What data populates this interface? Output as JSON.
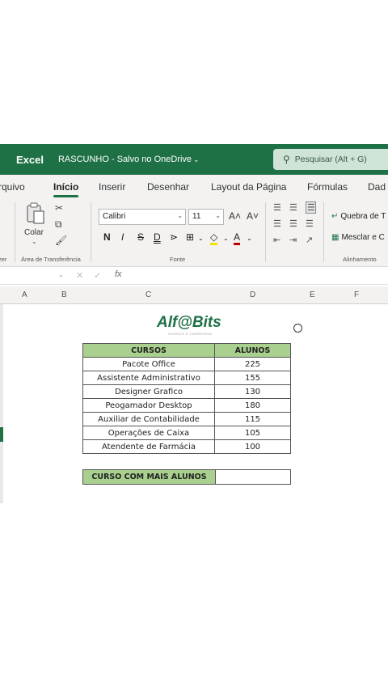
{
  "titlebar": {
    "app": "Excel",
    "doc": "RASCUNHO - Salvo no OneDrive",
    "search_placeholder": "Pesquisar (Alt + G)"
  },
  "tabs": [
    "rquivo",
    "Início",
    "Inserir",
    "Desenhar",
    "Layout da Página",
    "Fórmulas",
    "Dad"
  ],
  "active_tab": "Início",
  "ribbon": {
    "paste_label": "Colar",
    "clipboard_label": "Área de Transferência",
    "font_group_label": "Fonte",
    "align_group_label": "Alinhamento",
    "left_cut_label": "zer",
    "font_name": "Calibri",
    "font_size": "11",
    "grow": "A˄",
    "shrink": "A˅",
    "bold": "N",
    "italic": "I",
    "strike": "S",
    "double_underline": "D",
    "borders": "⊞",
    "fill": "◇",
    "font_color": "A",
    "wrap_text": "Quebra de T",
    "merge": "Mesclar e C"
  },
  "formula_bar": {
    "fx": "fx"
  },
  "columns": [
    "A",
    "B",
    "C",
    "D",
    "E",
    "F"
  ],
  "sheet": {
    "logo": "Alf@Bits",
    "logo_sub": "CURSOS E CARREIRAS",
    "headers": [
      "CURSOS",
      "ALUNOS"
    ],
    "rows": [
      [
        "Pacote Office",
        "225"
      ],
      [
        "Assistente Administrativo",
        "155"
      ],
      [
        "Designer Grafico",
        "130"
      ],
      [
        "Peogamador Desktop",
        "180"
      ],
      [
        "Auxiliar de Contabilidade",
        "115"
      ],
      [
        "Operações de Caixa",
        "105"
      ],
      [
        "Atendente de Farmácia",
        "100"
      ]
    ],
    "summary_label": "CURSO COM MAIS ALUNOS",
    "summary_value": ""
  },
  "colors": {
    "excel_green": "#1e7145",
    "header_fill": "#a9d08e"
  }
}
